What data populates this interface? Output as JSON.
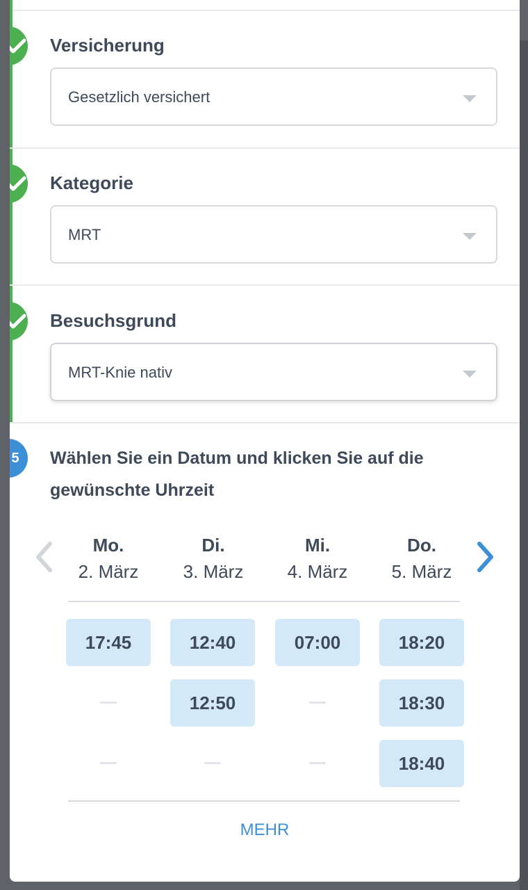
{
  "steps": [
    {
      "title": "Versicherung",
      "value": "Gesetzlich versichert"
    },
    {
      "title": "Kategorie",
      "value": "MRT"
    },
    {
      "title": "Besuchsgrund",
      "value": "MRT-Knie nativ"
    }
  ],
  "calendar": {
    "step_number": "5",
    "title": "Wählen Sie ein Datum und klicken Sie auf die gewünschte Uhrzeit",
    "days": [
      {
        "name": "Mo.",
        "date": "2. März",
        "slots": [
          "17:45"
        ]
      },
      {
        "name": "Di.",
        "date": "3. März",
        "slots": [
          "12:40",
          "12:50"
        ]
      },
      {
        "name": "Mi.",
        "date": "4. März",
        "slots": [
          "07:00"
        ]
      },
      {
        "name": "Do.",
        "date": "5. März",
        "slots": [
          "18:20",
          "18:30",
          "18:40"
        ]
      }
    ],
    "more_label": "MEHR"
  },
  "colors": {
    "done": "#4caf50",
    "active": "#3d8fd6",
    "slot_bg": "#d3e9f7"
  }
}
